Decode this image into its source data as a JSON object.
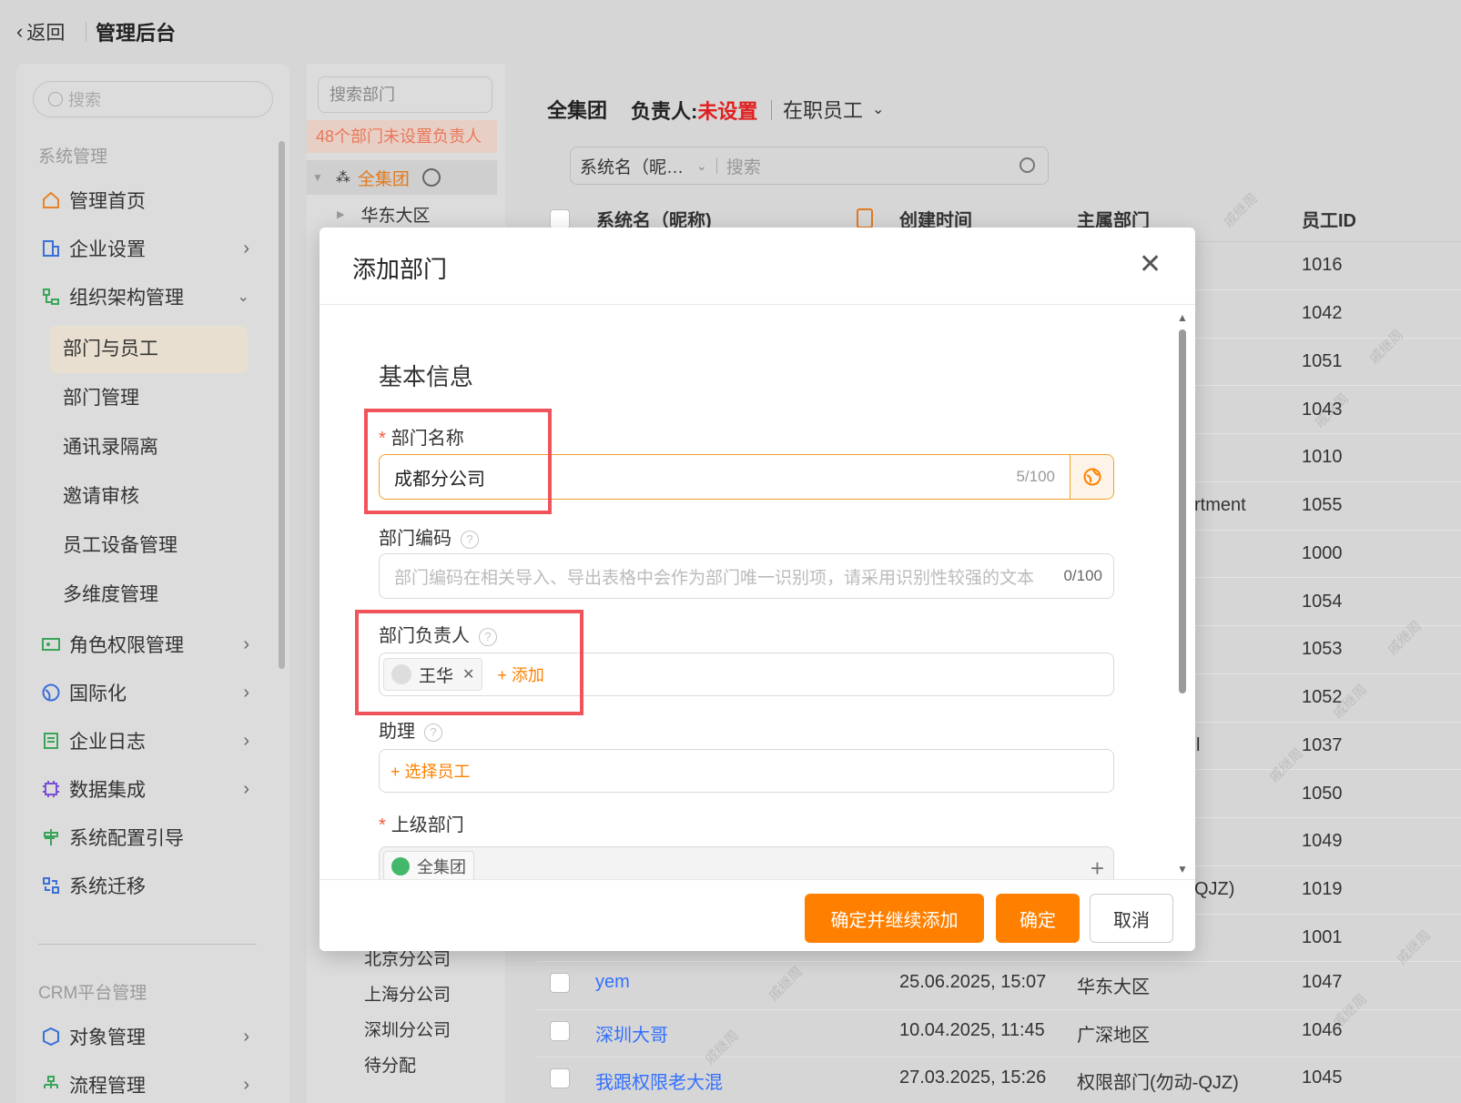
{
  "header": {
    "back_label": "返回",
    "title": "管理后台"
  },
  "sidebar": {
    "search_placeholder": "搜索",
    "section1": "系统管理",
    "items": [
      {
        "label": "管理首页",
        "icon": "home-icon"
      },
      {
        "label": "企业设置",
        "icon": "enterprise-settings-icon"
      },
      {
        "label": "组织架构管理",
        "icon": "org-structure-icon"
      },
      {
        "label": "角色权限管理",
        "icon": "role-permission-icon"
      },
      {
        "label": "国际化",
        "icon": "globe-icon"
      },
      {
        "label": "企业日志",
        "icon": "log-icon"
      },
      {
        "label": "数据集成",
        "icon": "chip-icon"
      },
      {
        "label": "系统配置引导",
        "icon": "config-guide-icon"
      },
      {
        "label": "系统迁移",
        "icon": "migration-icon"
      }
    ],
    "subitems": [
      "部门与员工",
      "部门管理",
      "通讯录隔离",
      "邀请审核",
      "员工设备管理",
      "多维度管理"
    ],
    "section2": "CRM平台管理",
    "crm_items": [
      {
        "label": "对象管理",
        "icon": "object-icon"
      },
      {
        "label": "流程管理",
        "icon": "flow-icon"
      }
    ]
  },
  "dept_panel": {
    "search_placeholder": "搜索部门",
    "warning": "48个部门未设置负责人",
    "root": "全集团",
    "child": "华东大区",
    "bottom_items": [
      "北京分公司",
      "上海分公司",
      "深圳分公司",
      "待分配"
    ]
  },
  "main": {
    "title": "全集团",
    "manager_label": "负责人:",
    "manager_value": "未设置",
    "status_filter": "在职员工",
    "search_field": "系统名（昵…",
    "search_placeholder": "搜索",
    "columns": [
      "系统名（昵称)",
      "创建时间",
      "主属部门",
      "员工ID"
    ],
    "ids": [
      "1016",
      "1042",
      "1051",
      "1043",
      "1010",
      "1055",
      "1000",
      "1054",
      "1053",
      "1052",
      "1037",
      "1050",
      "1049",
      "1019",
      "1001",
      "1047",
      "1046",
      "1045"
    ],
    "partial_dept": {
      "r6": "rtment",
      "r11": "l",
      "r14": "QJZ)"
    },
    "rows": [
      {
        "name": "yem",
        "created": "25.06.2025, 15:07",
        "dept": "华东大区",
        "id": "1047"
      },
      {
        "name": "深圳大哥",
        "created": "10.04.2025, 11:45",
        "dept": "广深地区",
        "id": "1046"
      },
      {
        "name": "我跟权限老大混",
        "created": "27.03.2025, 15:26",
        "dept": "权限部门(勿动-QJZ)",
        "id": "1045"
      }
    ],
    "watermark": "戚继周"
  },
  "modal": {
    "title": "添加部门",
    "section_title": "基本信息",
    "dept_name_label": "部门名称",
    "dept_name_value": "成都分公司",
    "dept_name_count": "5/100",
    "dept_code_label": "部门编码",
    "dept_code_placeholder": "部门编码在相关导入、导出表格中会作为部门唯一识别项，请采用识别性较强的文本",
    "dept_code_count": "0/100",
    "manager_label": "部门负责人",
    "manager_tag": "王华",
    "add_label": "+ 添加",
    "assistant_label": "助理",
    "select_employee": "+ 选择员工",
    "parent_label": "上级部门",
    "parent_tag": "全集团",
    "btn_confirm_continue": "确定并继续添加",
    "btn_confirm": "确定",
    "btn_cancel": "取消"
  },
  "colors": {
    "accent": "#ff8000",
    "warning_bg": "#fde4da",
    "warning_text": "#f0784f",
    "red": "#e02020",
    "link": "#3370ff",
    "active_bg": "#f1e6d4"
  }
}
